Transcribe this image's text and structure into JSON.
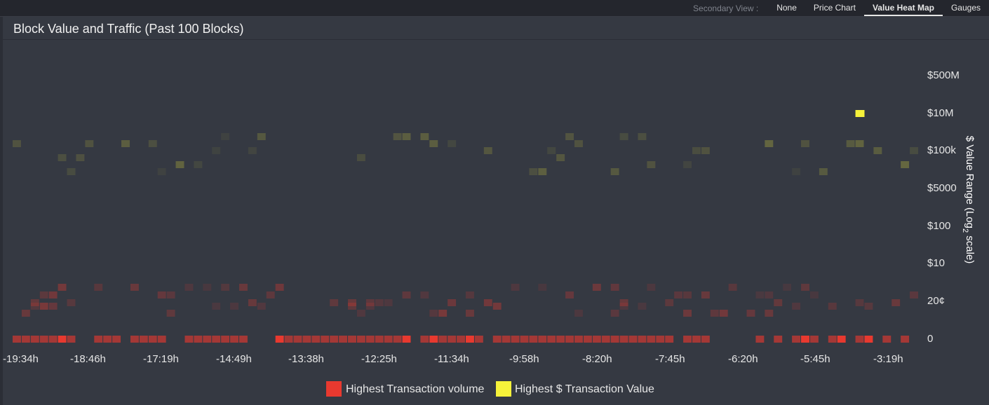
{
  "header": {
    "secondary_view_label": "Secondary View :",
    "tabs": [
      {
        "label": "None",
        "active": false
      },
      {
        "label": "Price Chart",
        "active": false
      },
      {
        "label": "Value Heat Map",
        "active": true
      },
      {
        "label": "Gauges",
        "active": false
      }
    ]
  },
  "panel": {
    "title": "Block Value and Traffic (Past 100 Blocks)"
  },
  "chart_data": {
    "type": "heatmap",
    "title": "Block Value and Traffic (Past 100 Blocks)",
    "ylabel_main": "$ Value Range (Log",
    "ylabel_sub": "2",
    "ylabel_tail": " scale)",
    "y_tick_labels": [
      "$500M",
      "$10M",
      "$100k",
      "$5000",
      "$100",
      "$10",
      "20¢",
      "0"
    ],
    "x_tick_labels": [
      "-19:34h",
      "-18:46h",
      "-17:19h",
      "-14:49h",
      "-13:38h",
      "-12:25h",
      "-11:34h",
      "-9:58h",
      "-8:20h",
      "-7:45h",
      "-6:20h",
      "-5:45h",
      "-3:19h"
    ],
    "legend": [
      {
        "name": "Highest Transaction volume",
        "color": "#e8392f"
      },
      {
        "name": "Highest $ Transaction Value",
        "color": "#f6f23a"
      }
    ],
    "num_blocks": 100,
    "zero_row_empty_blocks": [
      7,
      8,
      12,
      17,
      18,
      26,
      27,
      28,
      44,
      52,
      73,
      77,
      78,
      79,
      80,
      81,
      83,
      85,
      89,
      92,
      95,
      97,
      99
    ],
    "zero_row_highlight_blocks": [
      5,
      7,
      12,
      29,
      43,
      46,
      50,
      77,
      83,
      87,
      91,
      94
    ],
    "top_value_block": 93,
    "top_value_range": "$10M"
  },
  "colors": {
    "background": "#2b2e36",
    "panel": "#353942",
    "volume": "#e8392f",
    "value": "#f6f23a"
  }
}
